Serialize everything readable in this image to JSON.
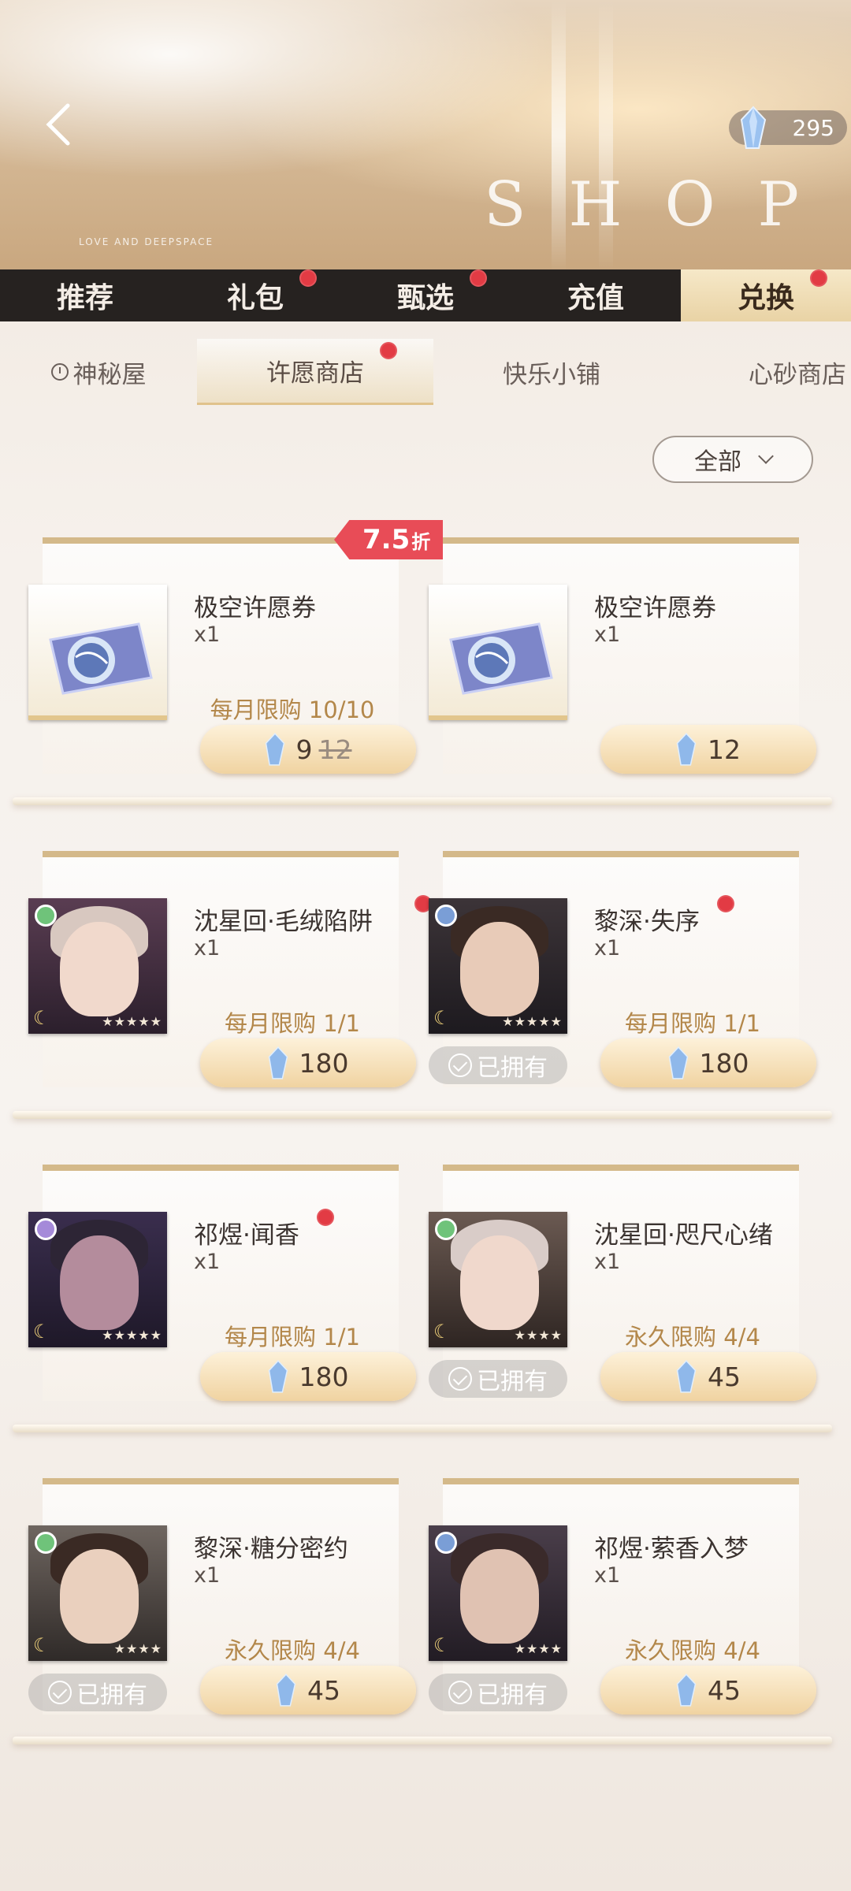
{
  "header": {
    "currency_amount": "295",
    "shop_letters": [
      "S",
      "H",
      "O",
      "P"
    ],
    "banner_small_text": "LOVE AND DEEPSPACE"
  },
  "main_tabs": [
    {
      "label": "推荐",
      "active": false,
      "dot": false
    },
    {
      "label": "礼包",
      "active": false,
      "dot": true
    },
    {
      "label": "甄选",
      "active": false,
      "dot": true
    },
    {
      "label": "充值",
      "active": false,
      "dot": false
    },
    {
      "label": "兑换",
      "active": true,
      "dot": true
    }
  ],
  "sub_tabs": [
    {
      "label": "神秘屋",
      "active": false
    },
    {
      "label": "许愿商店",
      "active": true
    },
    {
      "label": "快乐小铺",
      "active": false
    },
    {
      "label": "心砂商店",
      "active": false
    }
  ],
  "filter": {
    "label": "全部"
  },
  "items": [
    {
      "name": "极空许愿券",
      "qty": "x1",
      "limit": "每月限购 10/10",
      "price": "9",
      "old_price": "12",
      "discount": "7.5",
      "discount_unit": "折",
      "owned_label": ""
    },
    {
      "name": "极空许愿券",
      "qty": "x1",
      "limit": "",
      "price": "12",
      "old_price": "",
      "discount": "",
      "discount_unit": "",
      "owned_label": ""
    },
    {
      "name": "沈星回·毛绒陷阱",
      "qty": "x1",
      "limit": "每月限购 1/1",
      "price": "180",
      "old_price": "",
      "discount": "",
      "discount_unit": "",
      "owned_label": ""
    },
    {
      "name": "黎深·失序",
      "qty": "x1",
      "limit": "每月限购 1/1",
      "price": "180",
      "old_price": "",
      "discount": "",
      "discount_unit": "",
      "owned_label": "已拥有"
    },
    {
      "name": "祁煜·闻香",
      "qty": "x1",
      "limit": "每月限购 1/1",
      "price": "180",
      "old_price": "",
      "discount": "",
      "discount_unit": "",
      "owned_label": ""
    },
    {
      "name": "沈星回·咫尺心绪",
      "qty": "x1",
      "limit": "永久限购 4/4",
      "price": "45",
      "old_price": "",
      "discount": "",
      "discount_unit": "",
      "owned_label": "已拥有"
    },
    {
      "name": "黎深·糖分密约",
      "qty": "x1",
      "limit": "永久限购 4/4",
      "price": "45",
      "old_price": "",
      "discount": "",
      "discount_unit": "",
      "owned_label": "已拥有"
    },
    {
      "name": "祁煜·萦香入梦",
      "qty": "x1",
      "limit": "永久限购 4/4",
      "price": "45",
      "old_price": "",
      "discount": "",
      "discount_unit": "",
      "owned_label": "已拥有"
    }
  ],
  "colors": {
    "accent_red": "#e84c57",
    "price_button": "#f0d3a1",
    "limit_text": "#b3874a",
    "tab_bar": "#262220"
  }
}
